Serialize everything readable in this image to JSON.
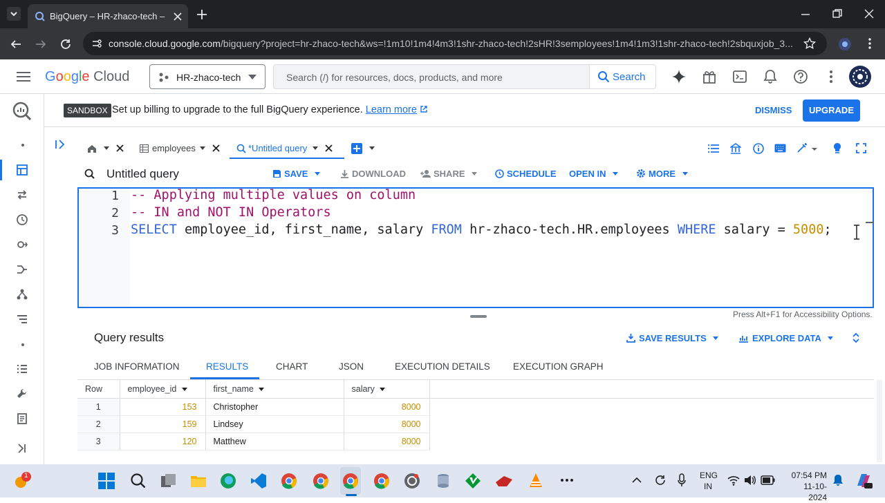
{
  "browser": {
    "tab_title": "BigQuery – HR-zhaco-tech – Google Cloud console",
    "url_host": "console.cloud.google.com",
    "url_path": "/bigquery?project=hr-zhaco-tech&ws=!1m10!1m4!4m3!1shr-zhaco-tech!2sHR!3semployees!1m4!1m3!1shr-zhaco-tech!2sbquxjob_3..."
  },
  "gcp_header": {
    "logo_text": "Google Cloud",
    "project": "HR-zhaco-tech",
    "search_placeholder": "Search (/) for resources, docs, products, and more",
    "search_button": "Search"
  },
  "banner": {
    "badge": "SANDBOX",
    "message": "Set up billing to upgrade to the full BigQuery experience.",
    "learn_more": "Learn more",
    "dismiss": "DISMISS",
    "upgrade": "UPGRADE"
  },
  "query_tabs": [
    {
      "label": "employees"
    },
    {
      "label": "*Untitled query"
    }
  ],
  "toolbar": {
    "title": "Untitled query",
    "save": "SAVE",
    "download": "DOWNLOAD",
    "share": "SHARE",
    "schedule": "SCHEDULE",
    "open_in": "OPEN IN",
    "more": "MORE"
  },
  "editor": {
    "line_numbers": [
      "1",
      "2",
      "3"
    ],
    "line1": "-- Applying multiple values on column",
    "line2": "-- IN and NOT IN Operators",
    "line3_select": "SELECT",
    "line3_cols": " employee_id, first_name, salary ",
    "line3_from": "FROM",
    "line3_table": " hr-zhaco-tech.HR.employees ",
    "line3_where": "WHERE",
    "line3_cond": " salary = ",
    "line3_value": "5000",
    "line3_end": ";"
  },
  "accessibility_hint": "Press Alt+F1 for Accessibility Options.",
  "results": {
    "title": "Query results",
    "save_results": "SAVE RESULTS",
    "explore_data": "EXPLORE DATA",
    "tabs": [
      "JOB INFORMATION",
      "RESULTS",
      "CHART",
      "JSON",
      "EXECUTION DETAILS",
      "EXECUTION GRAPH"
    ],
    "columns": [
      "Row",
      "employee_id",
      "first_name",
      "salary"
    ],
    "rows": [
      {
        "row": "1",
        "employee_id": "153",
        "first_name": "Christopher",
        "salary": "8000"
      },
      {
        "row": "2",
        "employee_id": "159",
        "first_name": "Lindsey",
        "salary": "8000"
      },
      {
        "row": "3",
        "employee_id": "120",
        "first_name": "Matthew",
        "salary": "8000"
      }
    ]
  },
  "taskbar": {
    "lang_top": "ENG",
    "lang_bottom": "IN",
    "time": "07:54 PM",
    "date": "11-10-2024",
    "notification_count": "1"
  }
}
